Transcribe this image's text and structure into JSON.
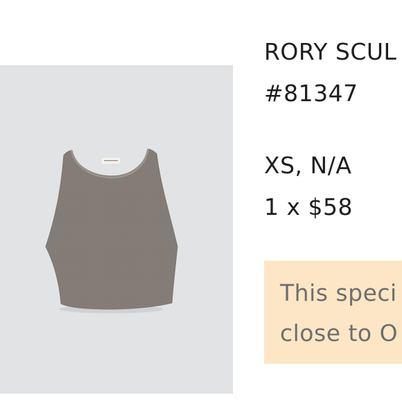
{
  "product": {
    "title": "RORY SCUL",
    "sku": "#81347",
    "variant": "XS, N/A",
    "quantity_price": "1 x $58",
    "image": {
      "description_icon": "tank-top-image",
      "background_color": "#e2e3e4",
      "garment_color": "#857d78"
    }
  },
  "notice": {
    "line1": "This speci",
    "line2": "close to O",
    "background_color": "#fde6c6"
  }
}
